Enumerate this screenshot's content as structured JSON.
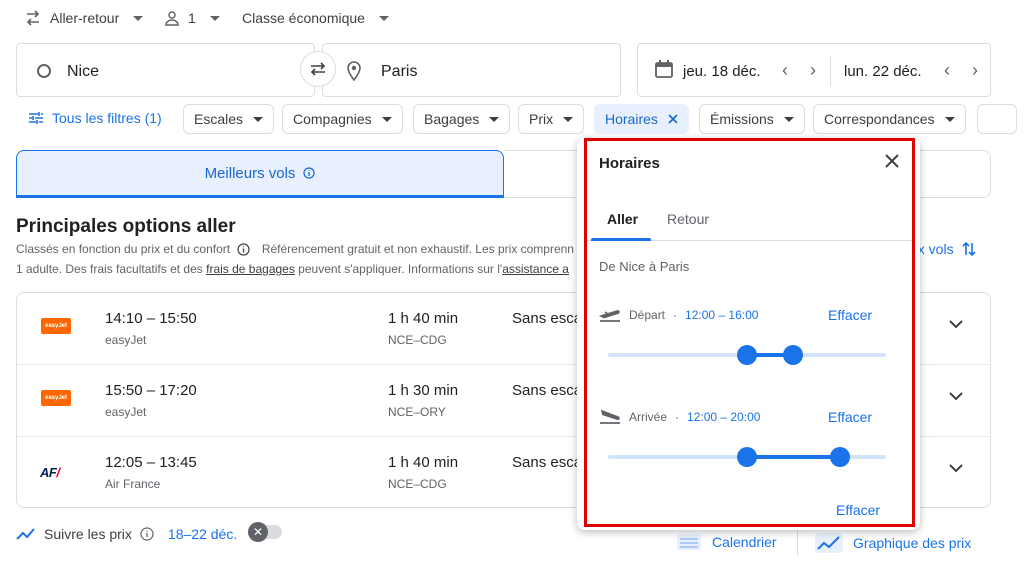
{
  "header": {
    "trip_type": "Aller-retour",
    "passengers": "1",
    "cabin_class": "Classe économique"
  },
  "search": {
    "origin": "Nice",
    "destination": "Paris",
    "depart_date": "jeu. 18 déc.",
    "return_date": "lun. 22 déc."
  },
  "filters": {
    "all_filters_label": "Tous les filtres (1)",
    "chips": [
      "Escales",
      "Compagnies",
      "Bagages",
      "Prix",
      "Horaires",
      "Émissions",
      "Correspondances"
    ],
    "active_chip": "Horaires"
  },
  "tabs": {
    "best_flights": "Meilleurs vols"
  },
  "results": {
    "title": "Principales options aller",
    "info_line1_a": "Classés en fonction du prix et du confort",
    "info_line1_b": "Référencement gratuit et non exhaustif. Les prix comprenn",
    "info_line2_a": "1 adulte. Des frais facultatifs et des ",
    "info_line2_link1": "frais de bagages",
    "info_line2_b": " peuvent s'appliquer. Informations sur l'",
    "info_line2_link2": "assistance a",
    "sort_label": "ux vols",
    "flights": [
      {
        "time": "14:10 – 15:50",
        "airline": "easyJet",
        "duration": "1 h 40 min",
        "route": "NCE–CDG",
        "stops": "Sans esca",
        "logo_text": "easyJet"
      },
      {
        "time": "15:50 – 17:20",
        "airline": "easyJet",
        "duration": "1 h 30 min",
        "route": "NCE–ORY",
        "stops": "Sans esca",
        "logo_text": "easyJet"
      },
      {
        "time": "12:05 – 13:45",
        "airline": "Air France",
        "duration": "1 h 40 min",
        "route": "NCE–CDG",
        "stops": "Sans esca",
        "logo_text": "AF"
      }
    ]
  },
  "footer": {
    "track_prices": "Suivre les prix",
    "track_dates": "18–22 déc.",
    "calendar": "Calendrier",
    "price_graph": "Graphique des prix"
  },
  "popup": {
    "title": "Horaires",
    "tab_outbound": "Aller",
    "tab_return": "Retour",
    "route": "De Nice à Paris",
    "departure_label": "Départ",
    "departure_range": "12:00 – 16:00",
    "departure_start_hour": 12,
    "departure_end_hour": 16,
    "arrival_label": "Arrivée",
    "arrival_range": "12:00 – 20:00",
    "arrival_start_hour": 12,
    "arrival_end_hour": 20,
    "clear_label": "Effacer",
    "clear_all_label": "Effacer"
  },
  "colors": {
    "accent": "#1a73e8",
    "highlight": "#e00000",
    "easyjet": "#ff6600"
  }
}
